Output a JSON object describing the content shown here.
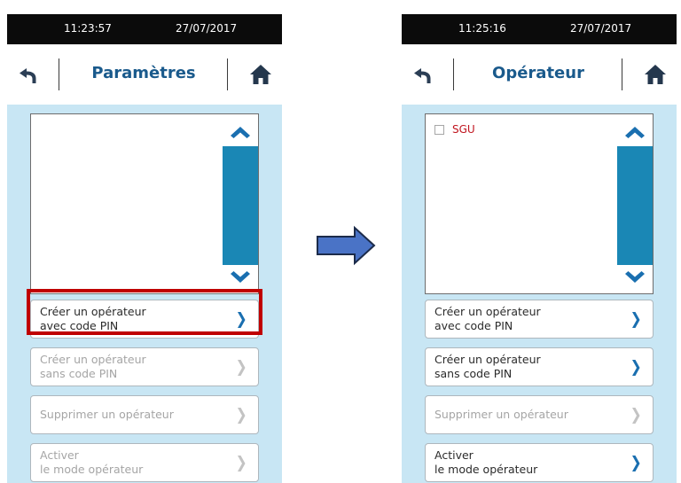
{
  "screens": {
    "left": {
      "status": {
        "time": "11:23:57",
        "date": "27/07/2017"
      },
      "title": "Paramètres",
      "list_items": [],
      "buttons": [
        {
          "label": "Créer un opérateur\navec code PIN",
          "enabled": true,
          "highlighted": true
        },
        {
          "label": "Créer un opérateur\nsans code PIN",
          "enabled": false
        },
        {
          "label": "Supprimer un opérateur",
          "enabled": false
        },
        {
          "label": "Activer\nle mode opérateur",
          "enabled": false
        }
      ]
    },
    "right": {
      "status": {
        "time": "11:25:16",
        "date": "27/07/2017"
      },
      "title": "Opérateur",
      "list_items": [
        {
          "label": "SGU",
          "checked": false
        }
      ],
      "buttons": [
        {
          "label": "Créer un opérateur\navec code PIN",
          "enabled": true
        },
        {
          "label": "Créer un opérateur\nsans code PIN",
          "enabled": true
        },
        {
          "label": "Supprimer un opérateur",
          "enabled": false
        },
        {
          "label": "Activer\nle mode opérateur",
          "enabled": true
        }
      ]
    }
  },
  "icons": {
    "back": "back-arrow-icon",
    "home": "home-icon",
    "scroll_up": "chevron-up-icon",
    "scroll_down": "chevron-down-icon",
    "button_chevron": "chevron-right-icon",
    "transition": "right-arrow-icon"
  },
  "colors": {
    "status_bar": "#0b0b0b",
    "title": "#1a5a8c",
    "content_bg": "#c8e6f4",
    "accent": "#1a87b5",
    "chevron_enabled": "#1a6fb0",
    "chevron_disabled": "#c3c3c3",
    "highlight": "#c00000",
    "item_text": "#c0141e",
    "transition_arrow": "#4a73c6"
  }
}
